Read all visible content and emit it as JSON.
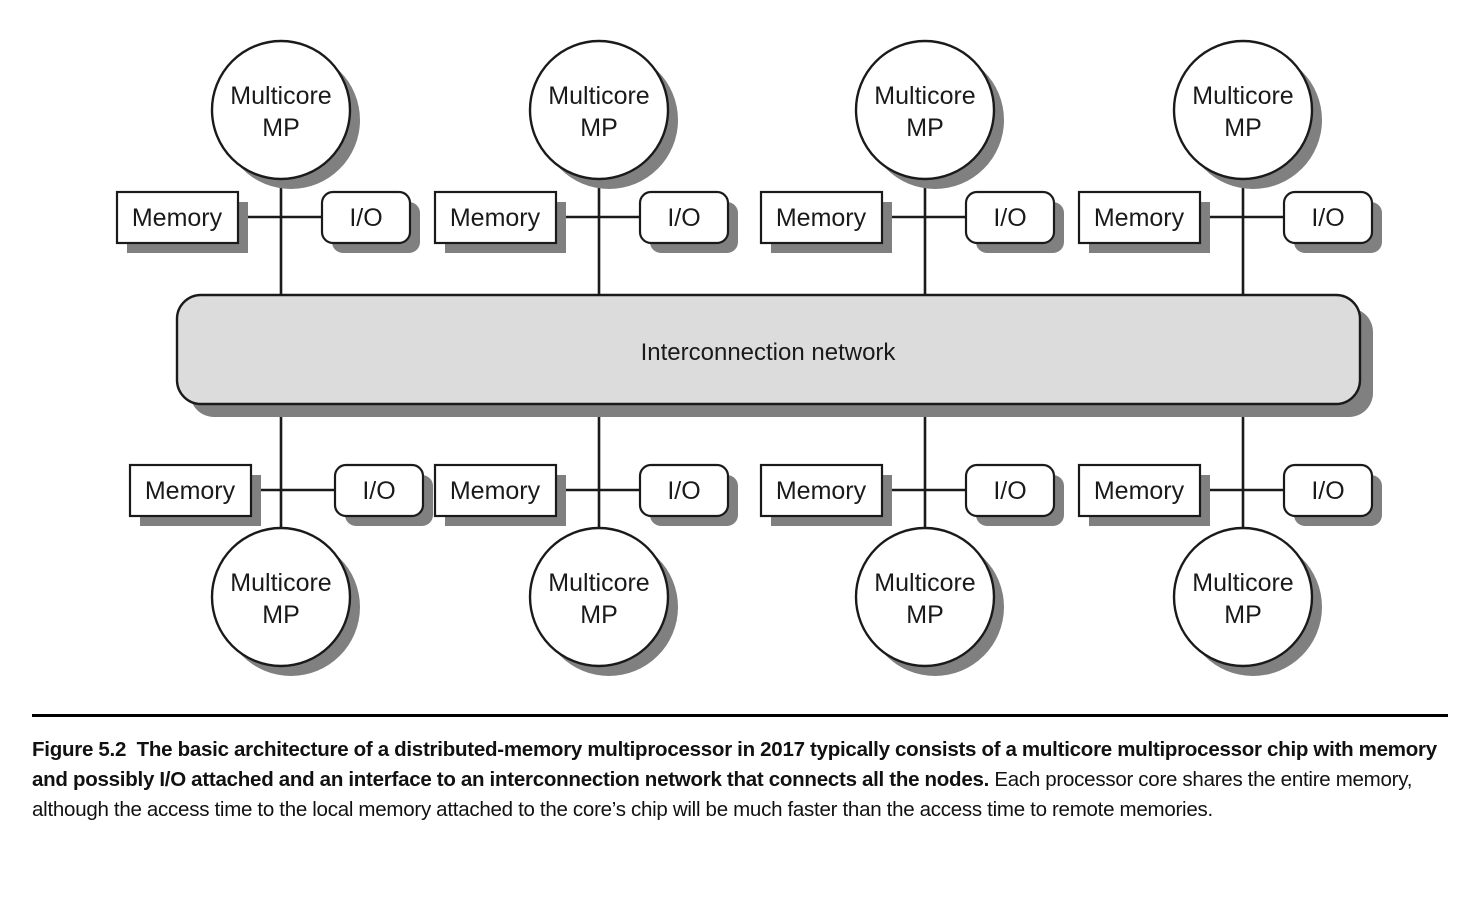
{
  "figure": {
    "network": {
      "label": "Interconnection network",
      "fill": "#dcdcdc",
      "stroke": "#1a1a1a",
      "shadow": "#808080"
    },
    "node_labels": {
      "processor_line1": "Multicore",
      "processor_line2": "MP",
      "memory": "Memory",
      "io": "I/O"
    },
    "top_nodes": [
      {
        "processor_line1": "Multicore",
        "processor_line2": "MP",
        "memory": "Memory",
        "io": "I/O"
      },
      {
        "processor_line1": "Multicore",
        "processor_line2": "MP",
        "memory": "Memory",
        "io": "I/O"
      },
      {
        "processor_line1": "Multicore",
        "processor_line2": "MP",
        "memory": "Memory",
        "io": "I/O"
      },
      {
        "processor_line1": "Multicore",
        "processor_line2": "MP",
        "memory": "Memory",
        "io": "I/O"
      }
    ],
    "bottom_nodes": [
      {
        "processor_line1": "Multicore",
        "processor_line2": "MP",
        "memory": "Memory",
        "io": "I/O"
      },
      {
        "processor_line1": "Multicore",
        "processor_line2": "MP",
        "memory": "Memory",
        "io": "I/O"
      },
      {
        "processor_line1": "Multicore",
        "processor_line2": "MP",
        "memory": "Memory",
        "io": "I/O"
      },
      {
        "processor_line1": "Multicore",
        "processor_line2": "MP",
        "memory": "Memory",
        "io": "I/O"
      }
    ],
    "colors": {
      "box_fill": "#ffffff",
      "box_stroke": "#1a1a1a",
      "shadow": "#808080",
      "line": "#1a1a1a",
      "text": "#1a1a1a"
    }
  },
  "caption": {
    "figure_number": "Figure 5.2",
    "bold_text": "The basic architecture of a distributed-memory multiprocessor in 2017 typically consists of a multicore multiprocessor chip with memory and possibly I/O attached and an interface to an interconnection network that connects all the nodes.",
    "normal_text": "Each processor core shares the entire memory, although the access time to the local memory attached to the core’s chip will be much faster than the access time to remote memories."
  }
}
